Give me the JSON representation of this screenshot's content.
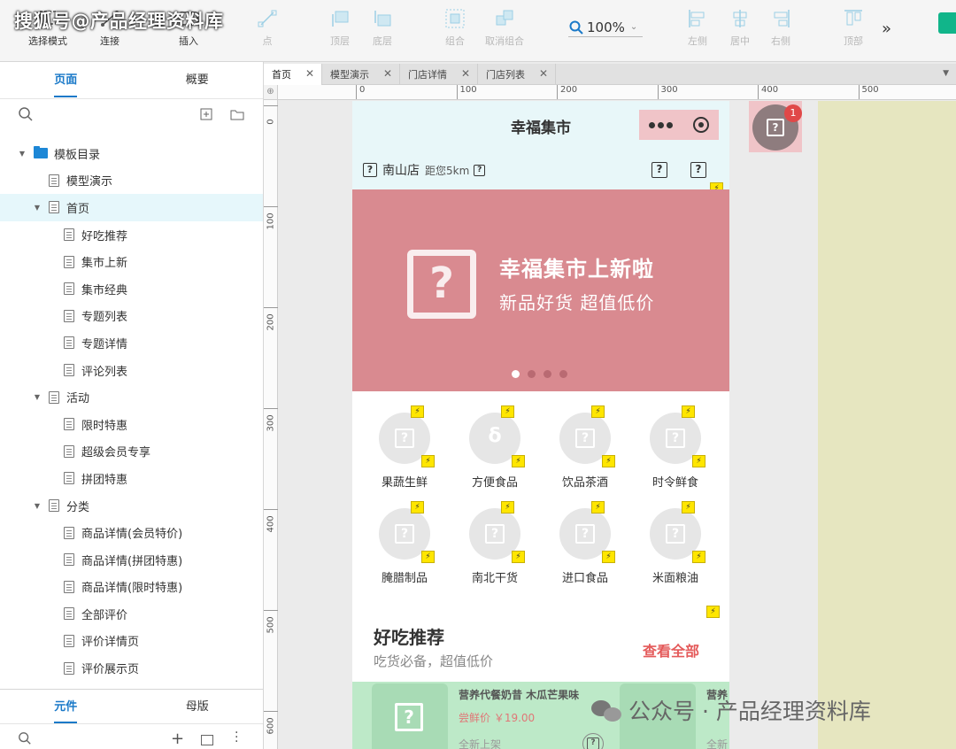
{
  "watermark_top": "搜狐号@产品经理资料库",
  "watermark_bottom": "公众号 · 产品经理资料库",
  "toolbar": {
    "tools": [
      {
        "label": "选择模式",
        "icon": "select-mode-icon",
        "enabled": true
      },
      {
        "label": "连接",
        "icon": "connect-icon",
        "enabled": true
      },
      {
        "label": "插入",
        "icon": "insert-icon",
        "enabled": true
      },
      {
        "label": "点",
        "icon": "point-icon",
        "enabled": false
      },
      {
        "label": "顶层",
        "icon": "bring-to-front-icon",
        "enabled": false
      },
      {
        "label": "底层",
        "icon": "send-to-back-icon",
        "enabled": false
      },
      {
        "label": "组合",
        "icon": "group-icon",
        "enabled": false
      },
      {
        "label": "取消组合",
        "icon": "ungroup-icon",
        "enabled": false
      },
      {
        "label": "左侧",
        "icon": "align-left-icon",
        "enabled": false
      },
      {
        "label": "居中",
        "icon": "align-center-icon",
        "enabled": false
      },
      {
        "label": "右侧",
        "icon": "align-right-icon",
        "enabled": false
      },
      {
        "label": "顶部",
        "icon": "align-top-icon",
        "enabled": false
      }
    ],
    "zoom": "100%",
    "more": "»"
  },
  "left_panel": {
    "tabs": [
      "页面",
      "概要"
    ],
    "bottom_tabs": [
      "元件",
      "母版"
    ],
    "tree": [
      {
        "label": "模板目录",
        "type": "folder",
        "level": 0,
        "expanded": true
      },
      {
        "label": "模型演示",
        "type": "page",
        "level": 1
      },
      {
        "label": "首页",
        "type": "page",
        "level": 1,
        "expanded": true,
        "selected": true
      },
      {
        "label": "好吃推荐",
        "type": "page",
        "level": 2
      },
      {
        "label": "集市上新",
        "type": "page",
        "level": 2
      },
      {
        "label": "集市经典",
        "type": "page",
        "level": 2
      },
      {
        "label": "专题列表",
        "type": "page",
        "level": 2
      },
      {
        "label": "专题详情",
        "type": "page",
        "level": 2
      },
      {
        "label": "评论列表",
        "type": "page",
        "level": 2
      },
      {
        "label": "活动",
        "type": "page",
        "level": 1,
        "expanded": true
      },
      {
        "label": "限时特惠",
        "type": "page",
        "level": 2
      },
      {
        "label": "超级会员专享",
        "type": "page",
        "level": 2
      },
      {
        "label": "拼团特惠",
        "type": "page",
        "level": 2
      },
      {
        "label": "分类",
        "type": "page",
        "level": 1,
        "expanded": true
      },
      {
        "label": "商品详情(会员特价)",
        "type": "page",
        "level": 2
      },
      {
        "label": "商品详情(拼团特惠)",
        "type": "page",
        "level": 2
      },
      {
        "label": "商品详情(限时特惠)",
        "type": "page",
        "level": 2
      },
      {
        "label": "全部评价",
        "type": "page",
        "level": 2
      },
      {
        "label": "评价详情页",
        "type": "page",
        "level": 2
      },
      {
        "label": "评价展示页",
        "type": "page",
        "level": 2
      }
    ]
  },
  "doc_tabs": [
    "首页",
    "模型演示",
    "门店详情",
    "门店列表"
  ],
  "ruler": {
    "h": [
      "0",
      "100",
      "200",
      "300",
      "400",
      "500"
    ],
    "v": [
      "0",
      "100",
      "200",
      "300",
      "400",
      "500",
      "600"
    ]
  },
  "app": {
    "title": "幸福集市",
    "store": "南山店",
    "distance": "距您5km",
    "banner_title": "幸福集市上新啦",
    "banner_sub": "新品好货  超值低价",
    "categories": [
      "果蔬生鲜",
      "方便食品",
      "饮品茶酒",
      "时令鲜食",
      "腌腊制品",
      "南北干货",
      "进口食品",
      "米面粮油"
    ],
    "section_title": "好吃推荐",
    "section_sub": "吃货必备，超值低价",
    "see_all": "查看全部",
    "product_name": "营养代餐奶昔 木瓜芒果味",
    "product_price": "尝鲜价 ￥19.00",
    "product_tag": "全新上架",
    "product2_name": "营养",
    "product2_tag": "全新",
    "badge_count": "1"
  },
  "colors": {
    "accent": "#1a79c8",
    "banner": "#d98a90",
    "header_bg": "#e8f7f9",
    "see_all": "#e45a5a",
    "product_strip": "#bde9c8"
  }
}
